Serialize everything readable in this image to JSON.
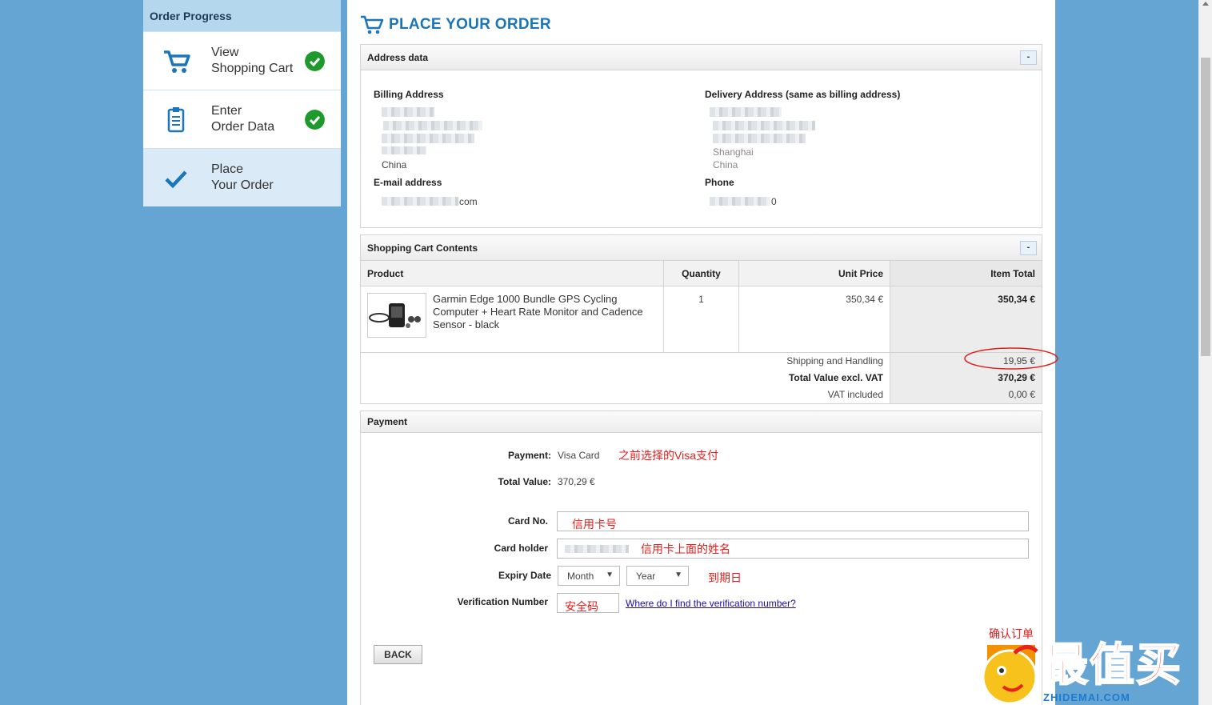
{
  "sidebar": {
    "title": "Order Progress",
    "steps": [
      {
        "line1": "View",
        "line2": "Shopping Cart",
        "icon": "cart-icon",
        "done": true
      },
      {
        "line1": "Enter",
        "line2": "Order Data",
        "icon": "clipboard-icon",
        "done": true
      },
      {
        "line1": "Place",
        "line2": "Your Order",
        "icon": "checkmark-icon",
        "done": false
      }
    ]
  },
  "page": {
    "title": "PLACE YOUR ORDER"
  },
  "address": {
    "heading": "Address data",
    "collapse": "-",
    "billing_label": "Billing Address",
    "billing_country": "China",
    "delivery_label": "Delivery Address (same as billing address)",
    "delivery_city": "Shanghai",
    "delivery_country": "China",
    "email_label": "E-mail address",
    "email_suffix": "com",
    "phone_label": "Phone",
    "phone_suffix": "0"
  },
  "cart": {
    "heading": "Shopping Cart Contents",
    "collapse": "-",
    "columns": {
      "product": "Product",
      "quantity": "Quantity",
      "unit_price": "Unit Price",
      "item_total": "Item Total"
    },
    "item": {
      "name": "Garmin Edge 1000 Bundle GPS Cycling Computer + Heart Rate Monitor and Cadence Sensor - black",
      "quantity": "1",
      "unit_price": "350,34 €",
      "item_total": "350,34 €"
    },
    "shipping_label": "Shipping and Handling",
    "shipping_value": "19,95 €",
    "total_label": "Total Value excl. VAT",
    "total_value": "370,29 €",
    "vat_label": "VAT included",
    "vat_value": "0,00 €"
  },
  "payment": {
    "heading": "Payment",
    "payment_label": "Payment:",
    "payment_value": "Visa Card",
    "payment_note": "之前选择的Visa支付",
    "total_label": "Total Value:",
    "total_value": "370,29 €",
    "card_no_label": "Card No.",
    "card_no_note": "信用卡号",
    "card_holder_label": "Card holder",
    "card_holder_note": "信用卡上面的姓名",
    "expiry_label": "Expiry Date",
    "month": "Month",
    "year": "Year",
    "expiry_note": "到期日",
    "verification_label": "Verification Number",
    "verification_note": "安全码",
    "verification_link": "Where do I find the verification number?",
    "confirm_note": "确认订单",
    "back_label": "BACK",
    "order_button_visible": "B"
  },
  "watermark": {
    "text": "最值买",
    "url": "ZHIDEMAI.COM"
  }
}
